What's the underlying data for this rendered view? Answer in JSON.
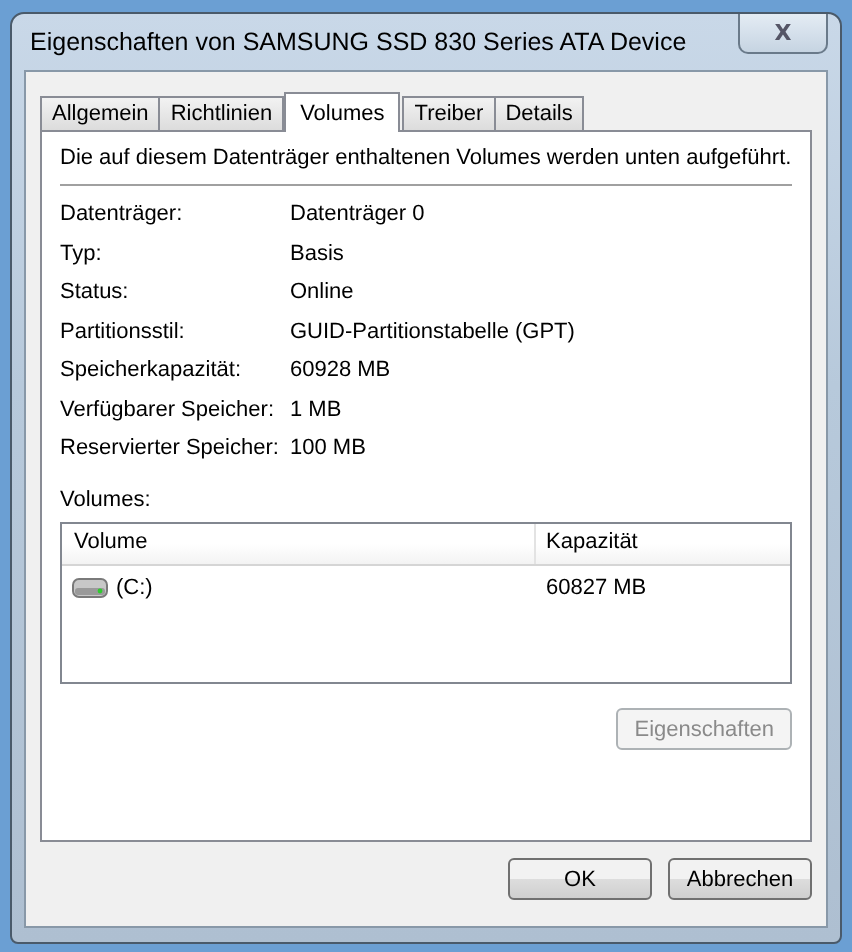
{
  "window": {
    "title": "Eigenschaften von SAMSUNG SSD 830 Series ATA Device",
    "close": "X"
  },
  "tabs": [
    {
      "label": "Allgemein",
      "selected": false
    },
    {
      "label": "Richtlinien",
      "selected": false
    },
    {
      "label": "Volumes",
      "selected": true
    },
    {
      "label": "Treiber",
      "selected": false
    },
    {
      "label": "Details",
      "selected": false
    }
  ],
  "intro": "Die auf diesem Datenträger enthaltenen Volumes werden unten aufgeführt.",
  "properties": [
    {
      "label": "Datenträger:",
      "value": "Datenträger 0"
    },
    {
      "label": "Typ:",
      "value": "Basis"
    },
    {
      "label": "Status:",
      "value": "Online"
    },
    {
      "label": "Partitionsstil:",
      "value": "GUID-Partitionstabelle (GPT)"
    },
    {
      "label": "Speicherkapazität:",
      "value": "60928 MB"
    },
    {
      "label": "Verfügbarer Speicher:",
      "value": "1 MB"
    },
    {
      "label": "Reservierter Speicher:",
      "value": "100 MB"
    }
  ],
  "volumes": {
    "label": "Volumes:",
    "columns": [
      "Volume",
      "Kapazität"
    ],
    "rows": [
      {
        "volume": "(C:)",
        "capacity": "60827 MB"
      }
    ],
    "properties_button": {
      "label": "Eigenschaften",
      "disabled": true
    }
  },
  "buttons": [
    "OK",
    "Abbrechen"
  ]
}
